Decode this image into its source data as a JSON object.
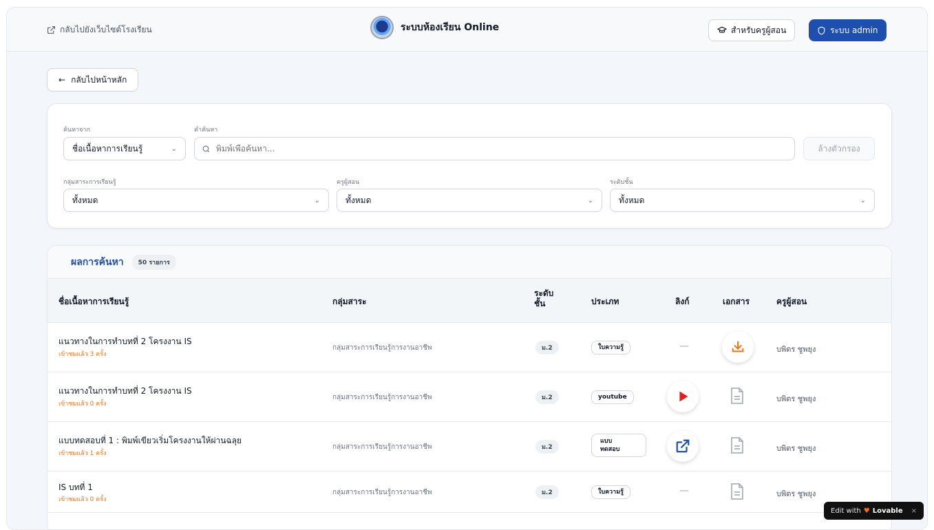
{
  "header": {
    "back_site": "กลับไปยังเว็บไซต์โรงเรียน",
    "brand_title": "ระบบห้องเรียน Online",
    "teacher_button": "สำหรับครูผู้สอน",
    "admin_button": "ระบบ admin"
  },
  "nav": {
    "home_button": "กลับไปหน้าหลัก"
  },
  "filters": {
    "search_from_label": "ค้นหาจาก",
    "search_from_value": "ชื่อเนื้อหาการเรียนรู้",
    "keyword_label": "คำค้นหา",
    "search_placeholder": "พิมพ์เพื่อค้นหา...",
    "clear_button": "ล้างตัวกรอง",
    "subject_label": "กลุ่มสาระการเรียนรู้",
    "subject_value": "ทั้งหมด",
    "teacher_label": "ครูผู้สอน",
    "teacher_value": "ทั้งหมด",
    "level_label": "ระดับชั้น",
    "level_value": "ทั้งหมด"
  },
  "results": {
    "title": "ผลการค้นหา",
    "count": "50 รายการ",
    "columns": {
      "name": "ชื่อเนื้อหาการเรียนรู้",
      "subject": "กลุ่มสาระ",
      "level_1": "ระดับ",
      "level_2": "ชั้น",
      "type": "ประเภท",
      "link": "ลิงก์",
      "doc": "เอกสาร",
      "teacher": "ครูผู้สอน"
    },
    "rows": [
      {
        "title": "แนวทางในการทำบทที่ 2 โครงงาน IS",
        "views": "เข้าชมแล้ว 3 ครั้ง",
        "subject": "กลุ่มสาระการเรียนรู้การงานอาชีพ",
        "level": "ม.2",
        "type": "ใบความรู้",
        "link": "—",
        "teacher": "บพิตร ชูพยุง"
      },
      {
        "title": "แนวทางในการทำบทที่ 2 โครงงาน IS",
        "views": "เข้าชมแล้ว 0 ครั้ง",
        "subject": "กลุ่มสาระการเรียนรู้การงานอาชีพ",
        "level": "ม.2",
        "type": "youtube",
        "teacher": "บพิตร ชูพยุง"
      },
      {
        "title": "แบบทดสอบที่ 1 : พิมพ์เขียวเริ่มโครงงานให้ผ่านฉลุย",
        "views": "เข้าชมแล้ว 1 ครั้ง",
        "subject": "กลุ่มสาระการเรียนรู้การงานอาชีพ",
        "level": "ม.2",
        "type_1": "แบบ",
        "type_2": "ทดสอบ",
        "teacher": "บพิตร ชูพยุง"
      },
      {
        "title": "IS บทที่ 1",
        "views": "เข้าชมแล้ว 0 ครั้ง",
        "subject": "กลุ่มสาระการเรียนรู้การงานอาชีพ",
        "level": "ม.2",
        "type": "ใบความรู้",
        "link": "—",
        "teacher": "บพิตร ชูพยุง"
      }
    ]
  },
  "badge": {
    "prefix": "Edit with",
    "brand": "Lovable",
    "close": "×"
  },
  "colors": {
    "primary": "#1e4fae",
    "accent": "#f97316",
    "youtube": "#e11d1d"
  }
}
